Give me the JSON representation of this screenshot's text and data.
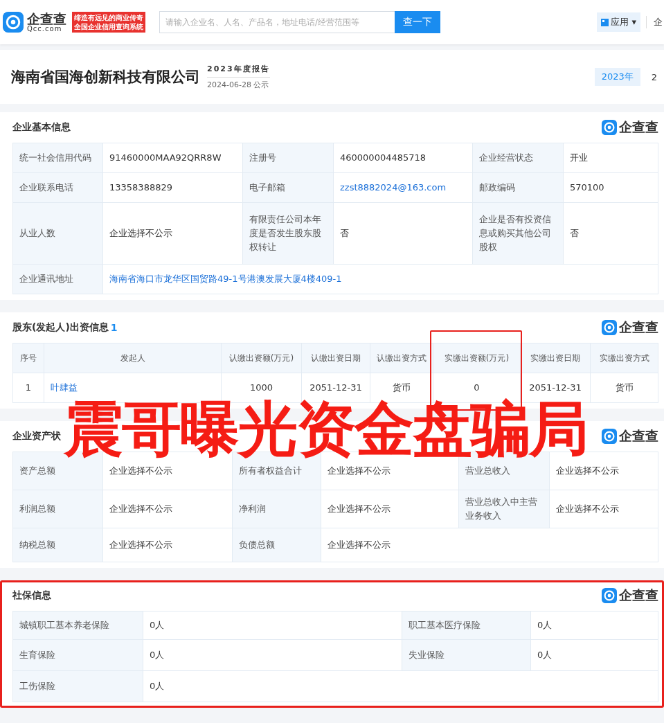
{
  "header": {
    "logo_name": "企查查",
    "logo_domain": "Qcc.com",
    "slogan": [
      "缔造有远见的商业传奇",
      "全国企业信用查询系统"
    ],
    "search_placeholder": "请输入企业名、人名、产品名，地址电话/经营范围等",
    "search_button": "查一下",
    "app_menu": "应用",
    "app_caret": "▾",
    "nav_cut": "企"
  },
  "company": {
    "name": "海南省国海创新科技有限公司",
    "report": "2023年度报告",
    "published": "2024-06-28 公示",
    "years": [
      {
        "label": "2023年",
        "selected": true
      },
      {
        "label": "2",
        "selected": false
      }
    ]
  },
  "sections": [
    {
      "title": "企业基本信息",
      "brand": "企查查",
      "highlighted": false,
      "rows": [
        [
          {
            "text": "统一社会信用代码",
            "kind": "label"
          },
          {
            "text": "91460000MAA92QRR8W",
            "kind": "value"
          },
          {
            "text": "注册号",
            "kind": "label"
          },
          {
            "text": "460000004485718",
            "kind": "value"
          },
          {
            "text": "企业经营状态",
            "kind": "label"
          },
          {
            "text": "开业",
            "kind": "value"
          }
        ],
        [
          {
            "text": "企业联系电话",
            "kind": "label"
          },
          {
            "text": "13358388829",
            "kind": "value"
          },
          {
            "text": "电子邮箱",
            "kind": "label"
          },
          {
            "text": "zzst8882024@163.com",
            "kind": "link"
          },
          {
            "text": "邮政编码",
            "kind": "label"
          },
          {
            "text": "570100",
            "kind": "value"
          }
        ],
        [
          {
            "text": "从业人数",
            "kind": "label"
          },
          {
            "text": "企业选择不公示",
            "kind": "value"
          },
          {
            "text": "有限责任公司本年度是否发生股东股权转让",
            "kind": "label"
          },
          {
            "text": "否",
            "kind": "value"
          },
          {
            "text": "企业是否有投资信息或购买其他公司股权",
            "kind": "label"
          },
          {
            "text": "否",
            "kind": "value"
          }
        ],
        [
          {
            "text": "企业通讯地址",
            "kind": "label"
          },
          {
            "text": "海南省海口市龙华区国贸路49-1号港澳发展大厦4楼409-1",
            "kind": "link"
          }
        ]
      ]
    },
    {
      "title": "股东(发起人)出资信息",
      "count": "1",
      "brand": "企查查",
      "highlighted": false,
      "columns": [
        {
          "label": "序号",
          "highlighted": false
        },
        {
          "label": "发起人",
          "highlighted": false
        },
        {
          "label": "认缴出资额(万元)",
          "highlighted": false
        },
        {
          "label": "认缴出资日期",
          "highlighted": false
        },
        {
          "label": "认缴出资方式",
          "highlighted": false
        },
        {
          "label": "实缴出资额(万元)",
          "highlighted": true
        },
        {
          "label": "实缴出资日期",
          "highlighted": false
        },
        {
          "label": "实缴出资方式",
          "highlighted": false
        }
      ],
      "rows": [
        [
          {
            "text": "1",
            "kind": "value"
          },
          {
            "text": "叶肆益",
            "kind": "link"
          },
          {
            "text": "1000",
            "kind": "value"
          },
          {
            "text": "2051-12-31",
            "kind": "value"
          },
          {
            "text": "货币",
            "kind": "value"
          },
          {
            "text": "0",
            "kind": "value"
          },
          {
            "text": "2051-12-31",
            "kind": "value"
          },
          {
            "text": "货币",
            "kind": "value"
          }
        ]
      ]
    },
    {
      "title": "企业资产状",
      "brand": "企查查",
      "highlighted": false,
      "rows": [
        [
          {
            "text": "资产总额",
            "kind": "label"
          },
          {
            "text": "企业选择不公示",
            "kind": "value"
          },
          {
            "text": "所有者权益合计",
            "kind": "label"
          },
          {
            "text": "企业选择不公示",
            "kind": "value"
          },
          {
            "text": "营业总收入",
            "kind": "label"
          },
          {
            "text": "企业选择不公示",
            "kind": "value"
          }
        ],
        [
          {
            "text": "利润总额",
            "kind": "label"
          },
          {
            "text": "企业选择不公示",
            "kind": "value"
          },
          {
            "text": "净利润",
            "kind": "label"
          },
          {
            "text": "企业选择不公示",
            "kind": "value"
          },
          {
            "text": "营业总收入中主营业务收入",
            "kind": "label"
          },
          {
            "text": "企业选择不公示",
            "kind": "value"
          }
        ],
        [
          {
            "text": "纳税总额",
            "kind": "label"
          },
          {
            "text": "企业选择不公示",
            "kind": "value"
          },
          {
            "text": "负债总额",
            "kind": "label"
          },
          {
            "text": "企业选择不公示",
            "kind": "value"
          }
        ]
      ]
    },
    {
      "title": "社保信息",
      "brand": "企查查",
      "highlighted": true,
      "rows": [
        [
          {
            "text": "城镇职工基本养老保险",
            "kind": "label"
          },
          {
            "text": "0人",
            "kind": "value"
          },
          {
            "text": "职工基本医疗保险",
            "kind": "label"
          },
          {
            "text": "0人",
            "kind": "value"
          }
        ],
        [
          {
            "text": "生育保险",
            "kind": "label"
          },
          {
            "text": "0人",
            "kind": "value"
          },
          {
            "text": "失业保险",
            "kind": "label"
          },
          {
            "text": "0人",
            "kind": "value"
          }
        ],
        [
          {
            "text": "工伤保险",
            "kind": "label"
          },
          {
            "text": "0人",
            "kind": "value"
          }
        ]
      ]
    }
  ],
  "headline": "震哥曝光资金盘骗局"
}
